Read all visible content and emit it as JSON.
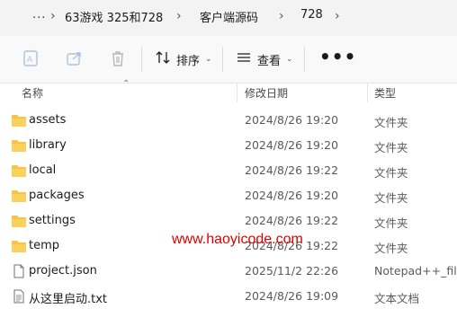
{
  "breadcrumb": {
    "more": "...",
    "segments": [
      "63游戏 325和728",
      "客户端源码",
      "728"
    ]
  },
  "toolbar": {
    "icons": [
      "ai-rename-icon",
      "share-icon",
      "delete-icon"
    ],
    "sort_label": "排序",
    "view_label": "查看",
    "more_label": "•••"
  },
  "columns": {
    "name": "名称",
    "date": "修改日期",
    "type": "类型"
  },
  "files": [
    {
      "name": "assets",
      "date": "2024/8/26 19:20",
      "type": "文件夹",
      "kind": "folder"
    },
    {
      "name": "library",
      "date": "2024/8/26 19:20",
      "type": "文件夹",
      "kind": "folder"
    },
    {
      "name": "local",
      "date": "2024/8/26 19:22",
      "type": "文件夹",
      "kind": "folder"
    },
    {
      "name": "packages",
      "date": "2024/8/26 19:20",
      "type": "文件夹",
      "kind": "folder"
    },
    {
      "name": "settings",
      "date": "2024/8/26 19:22",
      "type": "文件夹",
      "kind": "folder"
    },
    {
      "name": "temp",
      "date": "2024/8/26 19:22",
      "type": "文件夹",
      "kind": "folder"
    },
    {
      "name": "project.json",
      "date": "2025/11/2 22:26",
      "type": "Notepad++_file",
      "kind": "file"
    },
    {
      "name": "从这里启动.txt",
      "date": "2024/8/26 19:09",
      "type": "文本文档",
      "kind": "file"
    }
  ],
  "watermark": "www.haoyicode.com",
  "colors": {
    "folder": "#f6c344",
    "watermark": "#e00000"
  }
}
